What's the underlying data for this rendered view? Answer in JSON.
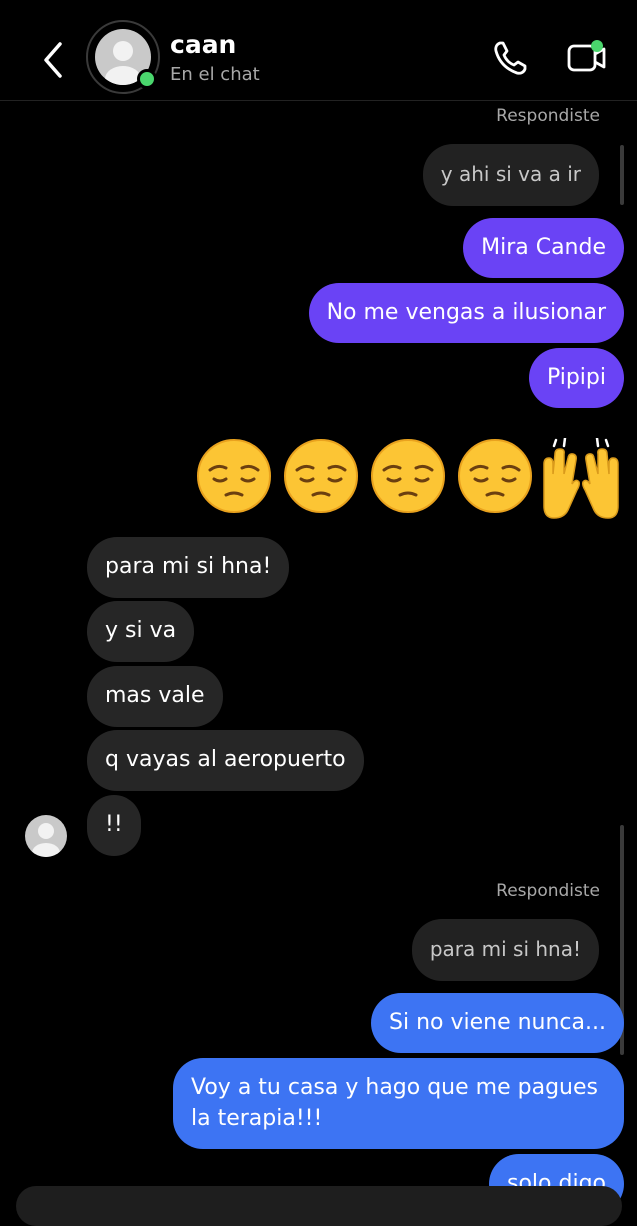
{
  "header": {
    "contact_name": "caan",
    "status": "En el chat",
    "back_icon": "chevron-left-icon",
    "call_icon": "phone-icon",
    "video_icon": "video-camera-icon",
    "online_color": "#4ad66d"
  },
  "messages": {
    "reply_label_1": "Respondiste",
    "reply_quote_1": "y ahi si va a ir",
    "out_1": "Mira Cande",
    "out_2": "No me vengas a ilusionar",
    "out_3": "Pipipi",
    "emoji_message": "😔😔😔😔🙌",
    "in_1": "para mi si hna!",
    "in_2": "y si va",
    "in_3": "mas vale",
    "in_4": "q vayas al aeropuerto",
    "in_5": "!!",
    "reply_label_2": "Respondiste",
    "reply_quote_2": "para mi si hna!",
    "out_4": "Si no viene nunca...",
    "out_5_line1": "Voy a tu casa y hago que me pagues",
    "out_5_line2": "la terapia!!!",
    "out_6": "solo digo"
  },
  "colors": {
    "bubble_purple": "#6a43f5",
    "bubble_blue": "#3d74f3",
    "bubble_incoming": "#262626",
    "background": "#000000"
  }
}
